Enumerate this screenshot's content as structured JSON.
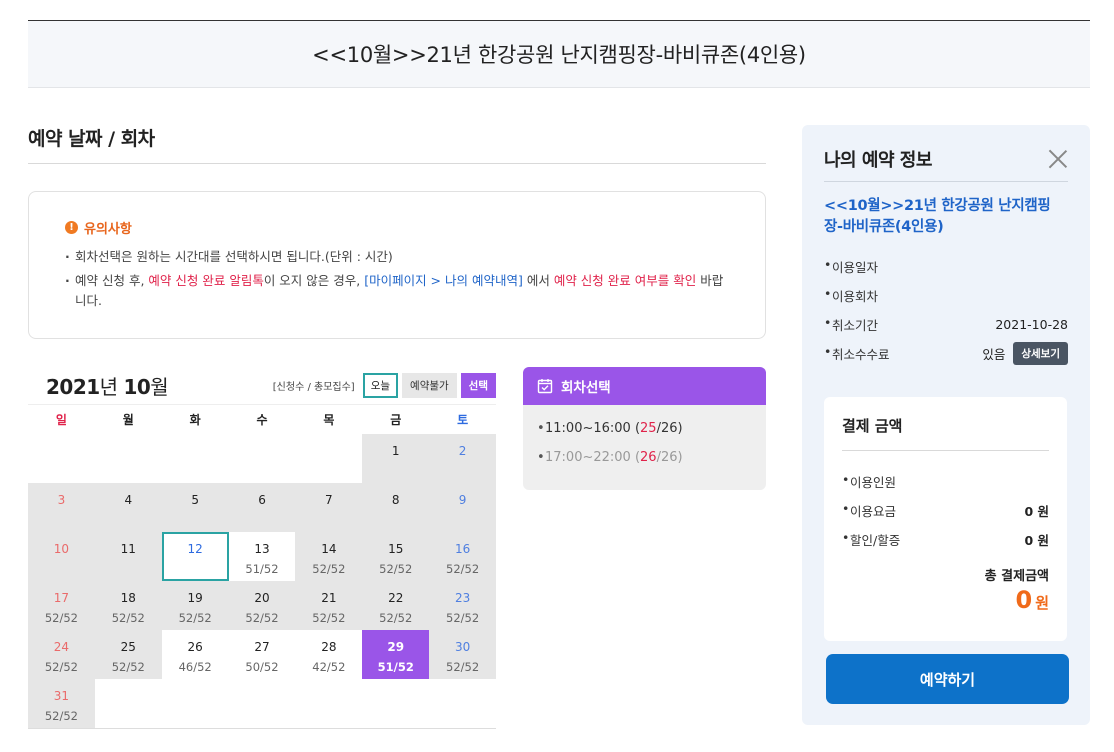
{
  "page_title": "<<10월>>21년 한강공원 난지캠핑장-바비큐존(4인용)",
  "section_title": "예약 날짜 / 회차",
  "notice": {
    "heading": "유의사항",
    "line1": "회차선택은 원하는 시간대를 선택하시면 됩니다.(단위 : 시간)",
    "line2_a": "예약 신청 후, ",
    "line2_red1": "예약 신청 완료 알림톡",
    "line2_b": "이 오지 않은 경우, ",
    "line2_blue": "[마이페이지 > 나의 예약내역]",
    "line2_c": " 에서 ",
    "line2_red2": "예약 신청 완료 여부를 확인",
    "line2_d": " 바랍니다."
  },
  "calendar": {
    "year": "2021",
    "year_suffix": "년 ",
    "month": "10",
    "month_suffix": "월",
    "legend_text": "[신청수 / 총모집수]",
    "legend_today": "오늘",
    "legend_closed": "예약불가",
    "legend_selected": "선택",
    "days_of_week": [
      "일",
      "월",
      "화",
      "수",
      "목",
      "금",
      "토"
    ],
    "weeks": [
      [
        {
          "d": "",
          "c": "",
          "t": "e"
        },
        {
          "d": "",
          "c": "",
          "t": "e"
        },
        {
          "d": "",
          "c": "",
          "t": "e"
        },
        {
          "d": "",
          "c": "",
          "t": "e"
        },
        {
          "d": "",
          "c": "",
          "t": "e"
        },
        {
          "d": "1",
          "c": "",
          "t": "g"
        },
        {
          "d": "2",
          "c": "",
          "t": "g"
        }
      ],
      [
        {
          "d": "3",
          "c": "",
          "t": "g"
        },
        {
          "d": "4",
          "c": "",
          "t": "g"
        },
        {
          "d": "5",
          "c": "",
          "t": "g"
        },
        {
          "d": "6",
          "c": "",
          "t": "g"
        },
        {
          "d": "7",
          "c": "",
          "t": "g"
        },
        {
          "d": "8",
          "c": "",
          "t": "g"
        },
        {
          "d": "9",
          "c": "",
          "t": "g"
        }
      ],
      [
        {
          "d": "10",
          "c": "",
          "t": "g"
        },
        {
          "d": "11",
          "c": "",
          "t": "g"
        },
        {
          "d": "12",
          "c": "",
          "t": "today"
        },
        {
          "d": "13",
          "c": "51/52",
          "t": "w"
        },
        {
          "d": "14",
          "c": "52/52",
          "t": "g"
        },
        {
          "d": "15",
          "c": "52/52",
          "t": "g"
        },
        {
          "d": "16",
          "c": "52/52",
          "t": "g"
        }
      ],
      [
        {
          "d": "17",
          "c": "52/52",
          "t": "g"
        },
        {
          "d": "18",
          "c": "52/52",
          "t": "g"
        },
        {
          "d": "19",
          "c": "52/52",
          "t": "g"
        },
        {
          "d": "20",
          "c": "52/52",
          "t": "g"
        },
        {
          "d": "21",
          "c": "52/52",
          "t": "g"
        },
        {
          "d": "22",
          "c": "52/52",
          "t": "g"
        },
        {
          "d": "23",
          "c": "52/52",
          "t": "g"
        }
      ],
      [
        {
          "d": "24",
          "c": "52/52",
          "t": "g"
        },
        {
          "d": "25",
          "c": "52/52",
          "t": "g"
        },
        {
          "d": "26",
          "c": "46/52",
          "t": "w"
        },
        {
          "d": "27",
          "c": "50/52",
          "t": "w"
        },
        {
          "d": "28",
          "c": "42/52",
          "t": "w"
        },
        {
          "d": "29",
          "c": "51/52",
          "t": "sel"
        },
        {
          "d": "30",
          "c": "52/52",
          "t": "g"
        }
      ],
      [
        {
          "d": "31",
          "c": "52/52",
          "t": "g"
        },
        {
          "d": "",
          "c": "",
          "t": "e"
        },
        {
          "d": "",
          "c": "",
          "t": "e"
        },
        {
          "d": "",
          "c": "",
          "t": "e"
        },
        {
          "d": "",
          "c": "",
          "t": "e"
        },
        {
          "d": "",
          "c": "",
          "t": "e"
        },
        {
          "d": "",
          "c": "",
          "t": "e"
        }
      ]
    ]
  },
  "session": {
    "heading": "회차선택",
    "slot1_time": "11:00~16:00 (",
    "slot1_applied": "25",
    "slot1_total": "/26)",
    "slot2_time": "17:00~22:00 (",
    "slot2_applied": "26",
    "slot2_total": "/26)"
  },
  "panel": {
    "heading": "나의 예약 정보",
    "item_title": "<<10월>>21년 한강공원 난지캠핑장-바비큐존(4인용)",
    "use_date_label": "이용일자",
    "use_session_label": "이용회차",
    "cancel_period_label": "취소기간",
    "cancel_period_value": "2021-10-28",
    "cancel_fee_label": "취소수수료",
    "cancel_fee_value": "있음",
    "detail_button": "상세보기",
    "payment": {
      "heading": "결제 금액",
      "people_label": "이용인원",
      "fee_label": "이용요금",
      "fee_value": "0 원",
      "discount_label": "할인/할증",
      "discount_value": "0 원",
      "total_label": "총 결제금액",
      "total_amount": "0",
      "total_unit": "원"
    },
    "reserve_button": "예약하기"
  },
  "colors": {
    "accent_purple": "#9a55e8",
    "primary_blue": "#0d72c9",
    "today_teal": "#2aa3a3",
    "alert_red": "#e0224a",
    "total_orange": "#f06a1a"
  }
}
